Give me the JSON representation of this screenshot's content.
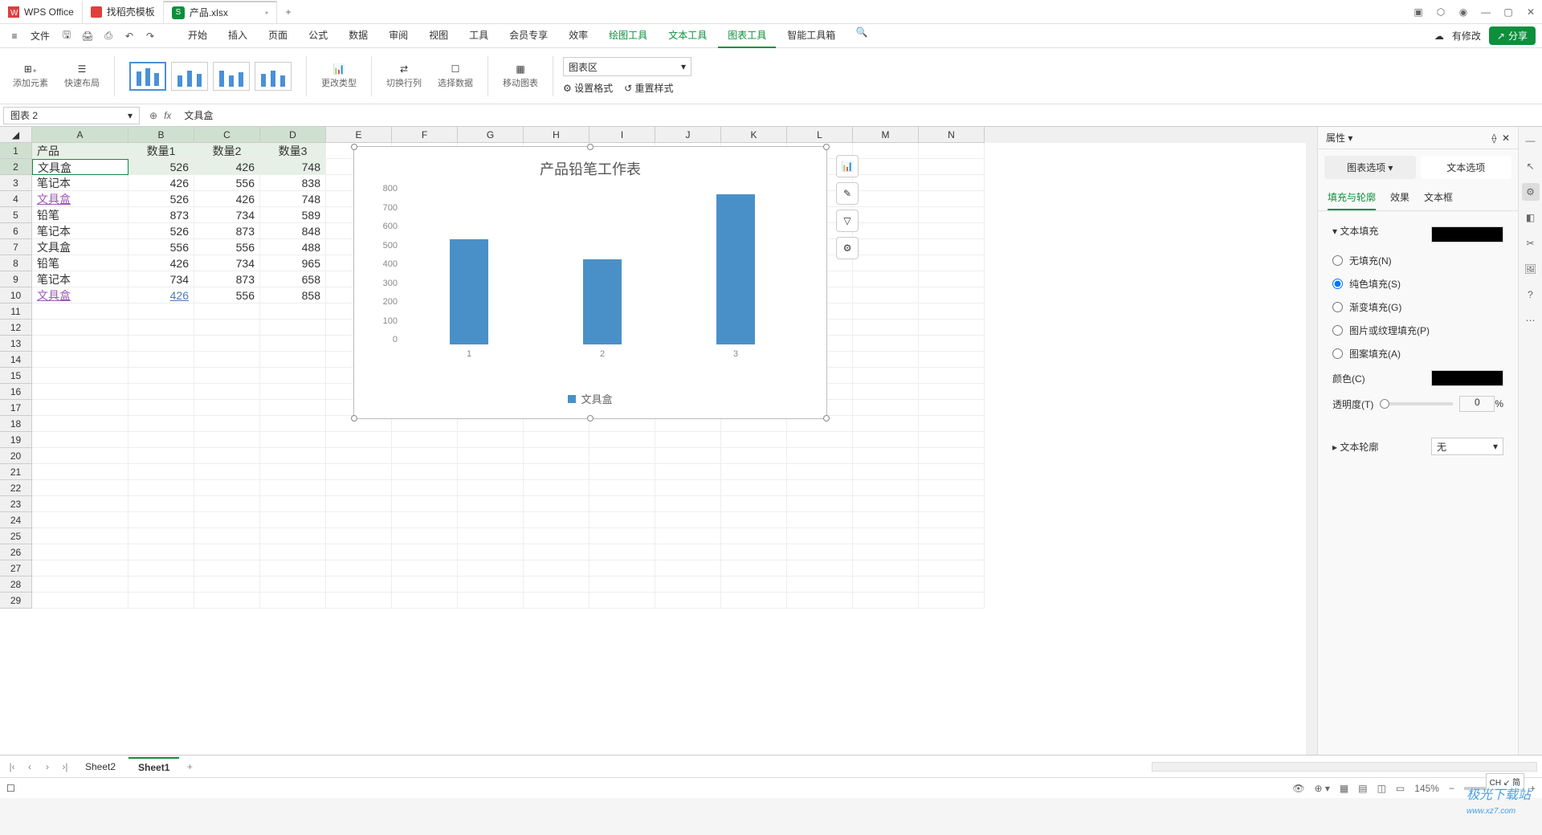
{
  "titlebar": {
    "app": "WPS Office",
    "tab2": "找稻壳模板",
    "tab3": "产品.xlsx",
    "add": "+"
  },
  "menubar": {
    "file": "文件",
    "modified": "有修改",
    "share": "分享"
  },
  "tabs": [
    "开始",
    "插入",
    "页面",
    "公式",
    "数据",
    "审阅",
    "视图",
    "工具",
    "会员专享",
    "效率",
    "绘图工具",
    "文本工具",
    "图表工具",
    "智能工具箱"
  ],
  "ribbon": {
    "addElem": "添加元素",
    "quickLayout": "快速布局",
    "changeType": "更改类型",
    "switchRC": "切换行列",
    "selectData": "选择数据",
    "moveChart": "移动图表",
    "area": "图表区",
    "setFmt": "设置格式",
    "resetStyle": "重置样式"
  },
  "fbar": {
    "name": "图表 2",
    "fx": "fx",
    "val": "文具盒"
  },
  "cols": [
    "A",
    "B",
    "C",
    "D",
    "E",
    "F",
    "G",
    "H",
    "I",
    "J",
    "K",
    "L",
    "M",
    "N"
  ],
  "rowsCount": 29,
  "header": [
    "产品",
    "数量1",
    "数量2",
    "数量3"
  ],
  "dataRows": [
    {
      "A": "文具盒",
      "B": "526",
      "C": "426",
      "D": "748",
      "cls": ""
    },
    {
      "A": "笔记本",
      "B": "426",
      "C": "556",
      "D": "838",
      "cls": ""
    },
    {
      "A": "文具盒",
      "B": "526",
      "C": "426",
      "D": "748",
      "cls": "purple"
    },
    {
      "A": "铅笔",
      "B": "873",
      "C": "734",
      "D": "589",
      "cls": ""
    },
    {
      "A": "笔记本",
      "B": "526",
      "C": "873",
      "D": "848",
      "cls": ""
    },
    {
      "A": "文具盒",
      "B": "556",
      "C": "556",
      "D": "488",
      "cls": ""
    },
    {
      "A": "铅笔",
      "B": "426",
      "C": "734",
      "D": "965",
      "cls": ""
    },
    {
      "A": "笔记本",
      "B": "734",
      "C": "873",
      "D": "658",
      "cls": ""
    },
    {
      "A": "文具盒",
      "B": "426",
      "C": "556",
      "D": "858",
      "cls": "purple",
      "blink": true
    }
  ],
  "chart_data": {
    "type": "bar",
    "title": "产品铅笔工作表",
    "categories": [
      "1",
      "2",
      "3"
    ],
    "values": [
      526,
      426,
      748
    ],
    "ylim": [
      0,
      800
    ],
    "yticks": [
      "800",
      "700",
      "600",
      "500",
      "400",
      "300",
      "200",
      "100",
      "0"
    ],
    "legend": "文具盒"
  },
  "rpanel": {
    "title": "属性",
    "tab1": "图表选项",
    "tab2": "文本选项",
    "sub1": "填充与轮廓",
    "sub2": "效果",
    "sub3": "文本框",
    "sec1": "文本填充",
    "opt_none": "无填充(N)",
    "opt_solid": "纯色填充(S)",
    "opt_grad": "渐变填充(G)",
    "opt_pic": "图片或纹理填充(P)",
    "opt_patt": "图案填充(A)",
    "color": "颜色(C)",
    "trans": "透明度(T)",
    "trans_val": "0",
    "pct": "%",
    "sec2": "文本轮廓",
    "outline_val": "无"
  },
  "sheets": {
    "s1": "Sheet2",
    "s2": "Sheet1"
  },
  "status": {
    "zoom": "145%"
  },
  "ime": "CH ↙ 简",
  "watermark": "极光下载站",
  "wm_url": "www.xz7.com"
}
